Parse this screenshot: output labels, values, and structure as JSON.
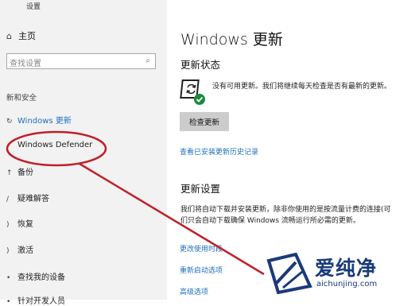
{
  "window": {
    "title": "设置"
  },
  "sidebar": {
    "home_icon": "home-icon",
    "home_label": "主页",
    "search_placeholder": "查找设置",
    "section_label": "新和安全",
    "items": [
      {
        "label": "Windows 更新",
        "icon": "refresh-icon"
      },
      {
        "label": "Windows Defender",
        "icon": "shield-icon"
      },
      {
        "label": "备份",
        "icon": "backup-icon"
      },
      {
        "label": "疑难解答",
        "icon": "wrench-icon"
      },
      {
        "label": "恢复",
        "icon": "restore-icon"
      },
      {
        "label": "激活",
        "icon": "check-circle-icon"
      },
      {
        "label": "查找我的设备",
        "icon": "person-icon"
      },
      {
        "label": "针对开发人员",
        "icon": "code-icon"
      }
    ]
  },
  "main": {
    "title": "Windows 更新",
    "status_heading": "更新状态",
    "status_text": "没有可用更新。我们将继续每天检查是否有最新的更新。",
    "check_button": "检查更新",
    "history_link": "查看已安装更新历史记录",
    "settings_heading": "更新设置",
    "settings_para1": "我们将自动下载并安装更新，除非你使用的是按流量计费的连接(可",
    "settings_para2": "们只会自动下载确保 Windows 流畅运行所必需的更新。",
    "links": [
      "更改使用时段",
      "重新启动选项",
      "高级选项"
    ]
  },
  "watermark": {
    "text": "爱纯净",
    "url": "aichunjing.com"
  },
  "colors": {
    "accent": "#1f6fbf",
    "annotation": "#c0202a",
    "sidebar_bg": "#f2f2f2",
    "watermark": "#1a3a7a"
  }
}
